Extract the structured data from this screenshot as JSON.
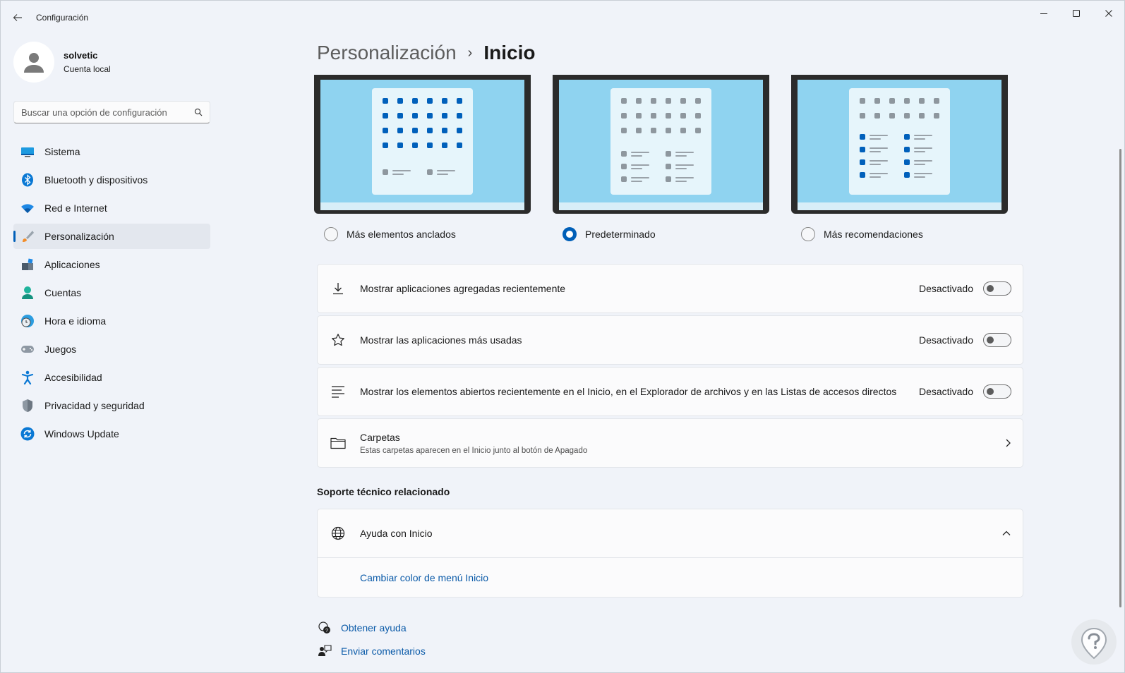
{
  "window": {
    "title": "Configuración",
    "controls": {
      "minimize": "minimize-icon",
      "maximize": "maximize-icon",
      "close": "close-icon"
    }
  },
  "profile": {
    "name": "solvetic",
    "account": "Cuenta local"
  },
  "search": {
    "placeholder": "Buscar una opción de configuración"
  },
  "sidebar": {
    "items": [
      {
        "label": "Sistema",
        "icon": "system-monitor-icon"
      },
      {
        "label": "Bluetooth y dispositivos",
        "icon": "bluetooth-icon"
      },
      {
        "label": "Red e Internet",
        "icon": "wifi-icon"
      },
      {
        "label": "Personalización",
        "icon": "paint-brush-icon",
        "selected": true
      },
      {
        "label": "Aplicaciones",
        "icon": "apps-icon"
      },
      {
        "label": "Cuentas",
        "icon": "person-icon"
      },
      {
        "label": "Hora e idioma",
        "icon": "clock-globe-icon"
      },
      {
        "label": "Juegos",
        "icon": "gamepad-icon"
      },
      {
        "label": "Accesibilidad",
        "icon": "accessibility-icon"
      },
      {
        "label": "Privacidad y seguridad",
        "icon": "shield-icon"
      },
      {
        "label": "Windows Update",
        "icon": "update-icon"
      }
    ]
  },
  "breadcrumb": {
    "parent": "Personalización",
    "separator": "›",
    "current": "Inicio"
  },
  "layouts": [
    {
      "label": "Más elementos anclados",
      "selected": false
    },
    {
      "label": "Predeterminado",
      "selected": true
    },
    {
      "label": "Más recomendaciones",
      "selected": false
    }
  ],
  "settings": [
    {
      "label": "Mostrar aplicaciones agregadas recientemente",
      "status": "Desactivado",
      "icon": "download-icon",
      "on": false
    },
    {
      "label": "Mostrar las aplicaciones más usadas",
      "status": "Desactivado",
      "icon": "star-icon",
      "on": false
    },
    {
      "label": "Mostrar los elementos abiertos recientemente en el Inicio, en el Explorador de archivos y en las Listas de accesos directos",
      "status": "Desactivado",
      "icon": "list-icon",
      "on": false
    }
  ],
  "folders": {
    "title": "Carpetas",
    "subtitle": "Estas carpetas aparecen en el Inicio junto al botón de Apagado"
  },
  "support": {
    "section_title": "Soporte técnico relacionado",
    "help_title": "Ayuda con Inicio",
    "link": "Cambiar color de menú Inicio"
  },
  "footer": {
    "help": "Obtener ayuda",
    "feedback": "Enviar comentarios"
  },
  "colors": {
    "accent": "#005fb8",
    "link": "#0a5aa8",
    "preview_bg": "#8fd3f0"
  }
}
